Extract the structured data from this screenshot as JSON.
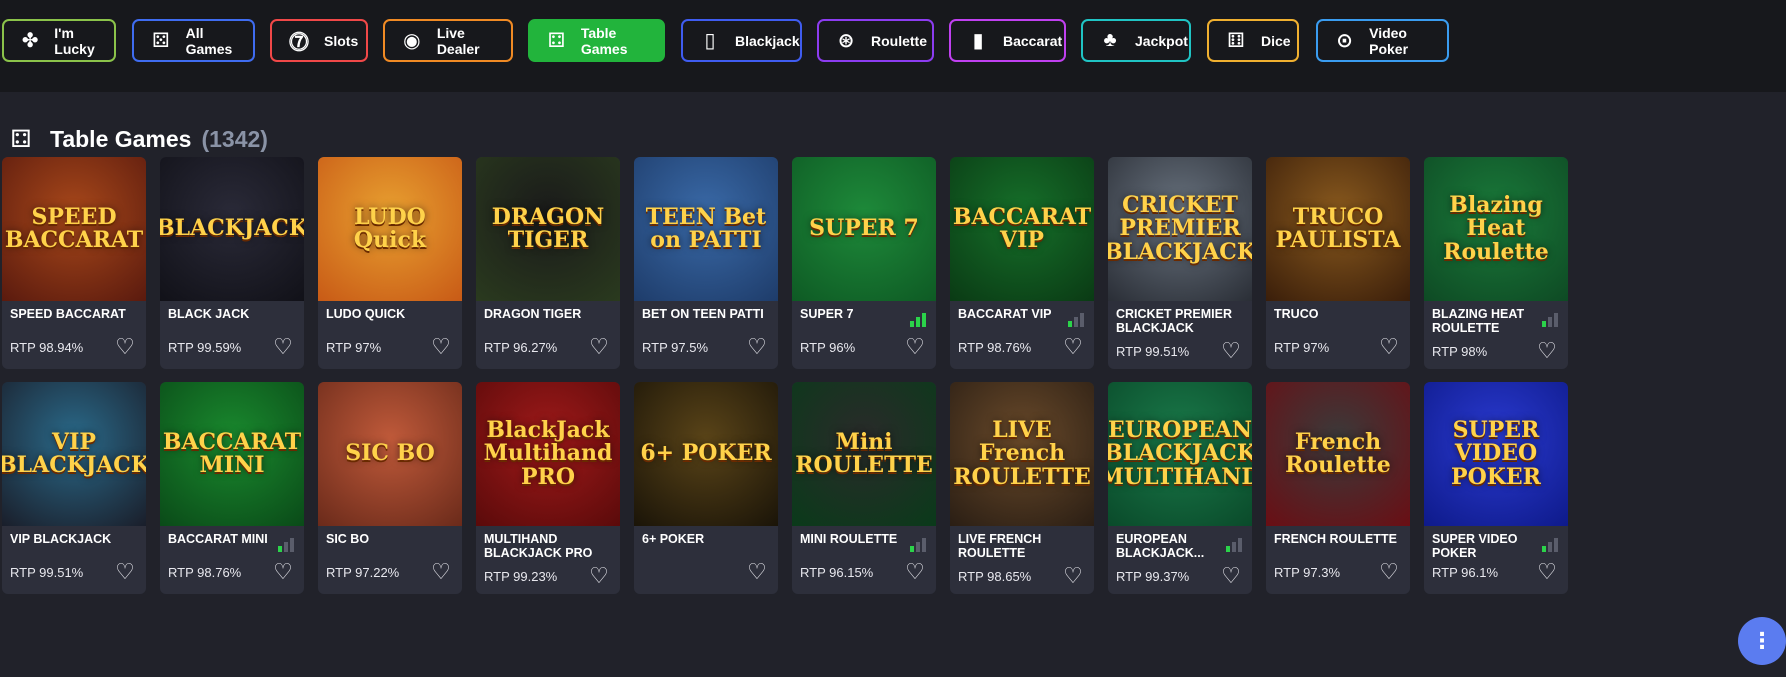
{
  "categories": [
    {
      "label": "I'm Lucky",
      "icon": "clover-icon",
      "glyph": "✤",
      "color": "#8bc34a",
      "active": false
    },
    {
      "label": "All Games",
      "icon": "casino-icon",
      "glyph": "⚄",
      "color": "#3f6cf0",
      "active": false
    },
    {
      "label": "Slots",
      "icon": "slot-machine-icon",
      "glyph": "⓻",
      "color": "#f04848",
      "active": false
    },
    {
      "label": "Live Dealer",
      "icon": "live-icon",
      "glyph": "◉",
      "color": "#f08a24",
      "active": false
    },
    {
      "label": "Table Games",
      "icon": "table-games-icon",
      "glyph": "⚃",
      "color": "#22b43c",
      "active": true
    },
    {
      "label": "Blackjack",
      "icon": "cards-icon",
      "glyph": "▯",
      "color": "#3f5cf0",
      "active": false
    },
    {
      "label": "Roulette",
      "icon": "roulette-icon",
      "glyph": "⊛",
      "color": "#8c3cf0",
      "active": false
    },
    {
      "label": "Baccarat",
      "icon": "baccarat-icon",
      "glyph": "▮",
      "color": "#c040f0",
      "active": false
    },
    {
      "label": "Jackpot",
      "icon": "cherries-icon",
      "glyph": "♣",
      "color": "#20c4c4",
      "active": false
    },
    {
      "label": "Dice",
      "icon": "dice-icon",
      "glyph": "⚅",
      "color": "#f0b030",
      "active": false
    },
    {
      "label": "Video Poker",
      "icon": "poker-chip-icon",
      "glyph": "⊙",
      "color": "#3a9cf0",
      "active": false
    }
  ],
  "section": {
    "title": "Table Games",
    "count": "(1342)",
    "icon": "table-games-icon"
  },
  "games": [
    {
      "name": "SPEED BACCARAT",
      "rtp": "RTP 98.94%",
      "bars": 0,
      "art": "SPEED BACCARAT",
      "bg": "#5a1a0e",
      "bg2": "#a8481a"
    },
    {
      "name": "BLACK JACK",
      "rtp": "RTP 99.59%",
      "bars": 0,
      "art": "BLACKJACK",
      "bg": "#111118",
      "bg2": "#2a2a38"
    },
    {
      "name": "LUDO QUICK",
      "rtp": "RTP 97%",
      "bars": 0,
      "art": "LUDO Quick",
      "bg": "#c85a16",
      "bg2": "#e8a030"
    },
    {
      "name": "DRAGON TIGER",
      "rtp": "RTP 96.27%",
      "bars": 0,
      "art": "DRAGON TIGER",
      "bg": "#2a3a1e",
      "bg2": "#1a1a1a"
    },
    {
      "name": "BET ON TEEN PATTI",
      "rtp": "RTP 97.5%",
      "bars": 0,
      "art": "TEEN Bet on PATTI",
      "bg": "#1e3c6a",
      "bg2": "#3a6aa8"
    },
    {
      "name": "SUPER 7",
      "rtp": "RTP 96%",
      "bars": 3,
      "art": "SUPER 7",
      "bg": "#0e5a24",
      "bg2": "#1e8a3a"
    },
    {
      "name": "BACCARAT VIP",
      "rtp": "RTP 98.76%",
      "bars": 1,
      "art": "BACCARAT VIP",
      "bg": "#0a3a14",
      "bg2": "#16702a"
    },
    {
      "name": "CRICKET PREMIER BLACKJACK",
      "rtp": "RTP 99.51%",
      "bars": 0,
      "art": "CRICKET PREMIER BLACKJACK",
      "bg": "#2a2e36",
      "bg2": "#6a7480"
    },
    {
      "name": "TRUCO",
      "rtp": "RTP 97%",
      "bars": 0,
      "art": "TRUCO PAULISTA",
      "bg": "#3a1e0a",
      "bg2": "#8a5a1e"
    },
    {
      "name": "BLAZING HEAT ROULETTE",
      "rtp": "RTP 98%",
      "bars": 1,
      "art": "Blazing Heat Roulette",
      "bg": "#0e4a24",
      "bg2": "#1a7a3a"
    },
    {
      "name": "VIP BLACKJACK",
      "rtp": "RTP 99.51%",
      "bars": 0,
      "art": "VIP BLACKJACK",
      "bg": "#1a1e2a",
      "bg2": "#2a6a8a"
    },
    {
      "name": "BACCARAT MINI",
      "rtp": "RTP 98.76%",
      "bars": 1,
      "art": "BACCARAT MINI",
      "bg": "#0a4a18",
      "bg2": "#1a8a2e"
    },
    {
      "name": "SIC BO",
      "rtp": "RTP 97.22%",
      "bars": 0,
      "art": "SIC BO",
      "bg": "#6a2a1a",
      "bg2": "#c05a3a"
    },
    {
      "name": "MULTIHAND BLACKJACK PRO",
      "rtp": "RTP 99.23%",
      "bars": 0,
      "art": "BlackJack Multihand PRO",
      "bg": "#5a0a0a",
      "bg2": "#a01a1a"
    },
    {
      "name": "6+ POKER",
      "rtp": "",
      "bars": 0,
      "art": "6+ POKER",
      "bg": "#1a1408",
      "bg2": "#5a4418"
    },
    {
      "name": "MINI ROULETTE",
      "rtp": "RTP 96.15%",
      "bars": 1,
      "art": "Mini ROULETTE",
      "bg": "#0a3a1a",
      "bg2": "#2a2a2a"
    },
    {
      "name": "LIVE FRENCH ROULETTE",
      "rtp": "RTP 98.65%",
      "bars": 0,
      "art": "LIVE French ROULETTE",
      "bg": "#2a1e14",
      "bg2": "#6a4a2a"
    },
    {
      "name": "EUROPEAN BLACKJACK...",
      "rtp": "RTP 99.37%",
      "bars": 1,
      "art": "EUROPEAN BLACKJACK MULTIHAND",
      "bg": "#0a4a2a",
      "bg2": "#1a7a4a"
    },
    {
      "name": "FRENCH ROULETTE",
      "rtp": "RTP 97.3%",
      "bars": 0,
      "art": "French Roulette",
      "bg": "#6a0e14",
      "bg2": "#3a3a3a"
    },
    {
      "name": "SUPER VIDEO POKER",
      "rtp": "RTP 96.1%",
      "bars": 1,
      "art": "SUPER VIDEO POKER",
      "bg": "#0e1a8a",
      "bg2": "#2a3ad0"
    }
  ],
  "fab": {
    "glyph": "⋮",
    "icon": "more-options-icon"
  },
  "heart_glyph": "♡"
}
